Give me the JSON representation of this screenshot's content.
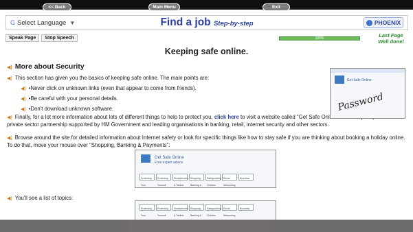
{
  "header": {
    "language_select": "Select Language",
    "title_main": "Find a job",
    "title_sub": "Step-by-step",
    "phoenix_button": "PHOENIX"
  },
  "toolbar": {
    "speak_page": "Speak Page",
    "stop_speech": "Stop Speech",
    "progress_percent": "100%",
    "progress_value": 1.0,
    "last_page": "Last Page",
    "well_done": "Well done!"
  },
  "page": {
    "heading": "Keeping safe online.",
    "section_title": "More about Security",
    "intro": "This section has given you the basics of keeping safe online. The main points are:",
    "bullets": [
      "•Never click on unknown links (even that appear to come from friends).",
      "•Be careful with your personal details.",
      "•Don't download unknown software."
    ],
    "finally_pre": "Finally, for a lot more information about lots of different things to help to protect you,",
    "finally_link": "click here",
    "finally_post": "to visit a website called \"Get Safe Online\". this is a joint public and private sector partnership supported by HM Government and leading organisations in banking, retail, internet security and other sectors.",
    "browse": "Browse around the site for detailed information about Internet safety or look for specific things like how to stay safe if you are thinking about booking a holiday online. To do that, move your mouse over \"Shopping, Banking & Payments\":",
    "topics": "You'll see a list of topics:"
  },
  "screenshots": {
    "password_label": "Password",
    "gso_title": "Get Safe Online",
    "gso_sub": "Free expert advice",
    "menu_items": [
      "Protecting Your Computer",
      "Protecting Yourself",
      "Smartphones & Tablets",
      "Shopping, Banking & Payments",
      "Safeguarding Children",
      "Social Networking",
      "Business"
    ]
  },
  "footer": {
    "back": "<< Back",
    "main_menu": "Main Menu",
    "exit": "Exit"
  },
  "colors": {
    "title": "#2a3fa0",
    "link": "#2c3ea8",
    "progress": "#6dbb5a",
    "well_done": "#2c8a2c",
    "footer": "#6b6b6b"
  }
}
